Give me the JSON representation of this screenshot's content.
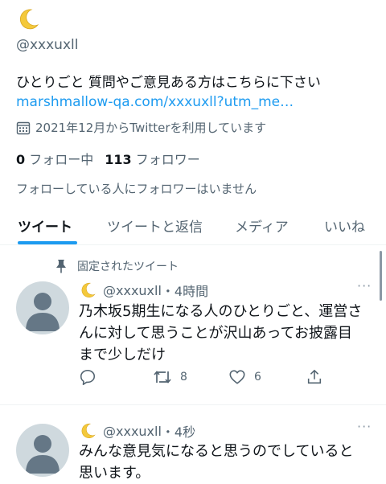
{
  "profile": {
    "handle": "@xxxuxll",
    "bio": "ひとりごと 質問やご意見ある方はこちらに下さい",
    "link": "marshmallow-qa.com/xxxuxll?utm_me…",
    "joined": "2021年12月からTwitterを利用しています",
    "following_count": "0",
    "following_label": "フォロー中",
    "followers_count": "113",
    "followers_label": "フォロワー",
    "not_followed_note": "フォローしている人にフォロワーはいません"
  },
  "tabs": [
    {
      "label": "ツイート",
      "active": true
    },
    {
      "label": "ツイートと返信",
      "active": false
    },
    {
      "label": "メディア",
      "active": false
    },
    {
      "label": "いいね",
      "active": false
    }
  ],
  "tweets": [
    {
      "pinned_label": "固定されたツイート",
      "handle": "@xxxuxll",
      "time": "・4時間",
      "text_lines": [
        "乃木坂5期生になる人のひとりごと、運営さ",
        "んに対して思うことが沢山あってお披露目",
        "まで少しだけ"
      ],
      "retweets": "8",
      "likes": "6",
      "more": "···"
    },
    {
      "handle": "@xxxuxll",
      "time": "・4秒",
      "text_lines": [
        "みんな意見気になると思うのでしていると",
        "思います。"
      ],
      "more": "···"
    }
  ],
  "icons": {
    "moon": "crescent-moon-emoji",
    "calendar": "calendar-icon",
    "pin": "pin-icon",
    "reply": "reply-icon",
    "retweet": "retweet-icon",
    "like": "heart-icon",
    "share": "share-icon",
    "more": "more-icon"
  },
  "colors": {
    "accent": "#1d9bf0",
    "text": "#0f1419",
    "secondary": "#536471",
    "moon": "#f4c93b"
  }
}
